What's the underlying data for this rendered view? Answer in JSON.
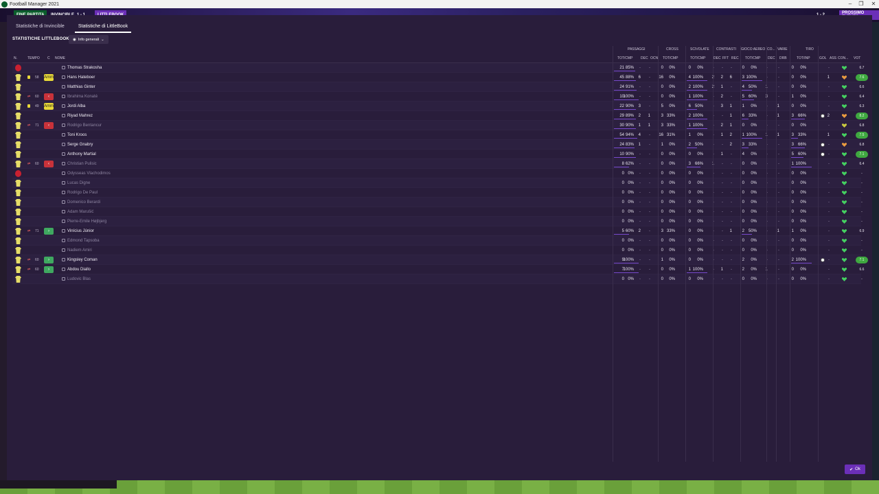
{
  "window": {
    "title": "Football Manager 2021",
    "controls": [
      "–",
      "❐",
      "✕"
    ]
  },
  "topbar": {
    "status": "FINE PARTITA",
    "home": "INVINCIBLE",
    "score": "1 - 1",
    "away": "LITTLEBOOK",
    "right_score": "1 - 2",
    "right_label": "PROSSIMO EVENTO"
  },
  "tabs": [
    {
      "label": "Statistiche di Invincible"
    },
    {
      "label": "Statistiche di LittleBook"
    }
  ],
  "section": {
    "title": "STATISTICHE LITTLEBOOK",
    "view_label": "Info generali"
  },
  "groups": [
    "PASSAGGI",
    "CROSS",
    "SCIVOLATE",
    "CONTRASTI",
    "GIOCO AEREO",
    "CO...",
    "VARIE",
    "TIRO"
  ],
  "columns": [
    "N.",
    "TEMPO",
    "C",
    "NOME",
    "TOT/CMP",
    "DEC",
    "OCN",
    "TOT/CMP",
    "TOT/CMP",
    "DEC",
    "FFT",
    "REC",
    "TOT/CMP",
    "DEC",
    "DRB",
    "TOT/INP",
    "GOL",
    "ASS",
    "CON...",
    "VOT"
  ],
  "players": [
    {
      "name": "Thomas Strakosha",
      "shirt": "red",
      "dim": false,
      "pass": "21",
      "passpct": "85%",
      "dec": "-",
      "ocn": "-",
      "cross": "0",
      "crosspct": "0%",
      "sciv": "0",
      "scivpct": "0%",
      "cdec": "-",
      "fft": "-",
      "rec": "-",
      "air": "0",
      "airpct": "0%",
      "co": "-",
      "drb": "-",
      "tiro": "0",
      "tiropct": "0%",
      "gol": "",
      "ass": "-",
      "heart": "green",
      "vot": "6.7"
    },
    {
      "name": "Hans Hateboer",
      "shirt": "yellow",
      "dim": false,
      "card": true,
      "minute": "58",
      "sub": "bkg",
      "subtext": "Amm.",
      "pass": "45",
      "passpct": "88%",
      "dec": "6",
      "ocn": "-",
      "cross": "16",
      "crosspct": "0%",
      "sciv": "4",
      "scivpct": "100%",
      "cdec": "2",
      "fft": "2",
      "rec": "6",
      "air": "3",
      "airpct": "100%",
      "co": "-",
      "drb": "-",
      "tiro": "0",
      "tiropct": "0%",
      "gol": "",
      "ass": "1",
      "heart": "orange",
      "vot": "7.6"
    },
    {
      "name": "Matthias Ginter",
      "shirt": "yellow",
      "dim": false,
      "pass": "24",
      "passpct": "91%",
      "dec": "-",
      "ocn": "-",
      "cross": "0",
      "crosspct": "0%",
      "sciv": "2",
      "scivpct": "100%",
      "cdec": "2",
      "fft": "1",
      "rec": "-",
      "air": "4",
      "airpct": "50%",
      "co": "1",
      "drb": "-",
      "tiro": "0",
      "tiropct": "0%",
      "gol": "",
      "ass": "-",
      "heart": "green",
      "vot": "6.6"
    },
    {
      "name": "Ibrahima Konaté",
      "shirt": "yellow",
      "dim": true,
      "swap": "⇄",
      "minute": "60",
      "sub": "out",
      "pass": "10",
      "passpct": "100%",
      "dec": "-",
      "ocn": "-",
      "cross": "0",
      "crosspct": "0%",
      "sciv": "1",
      "scivpct": "100%",
      "cdec": "-",
      "fft": "2",
      "rec": "-",
      "air": "5",
      "airpct": "60%",
      "co": "3",
      "drb": "-",
      "tiro": "1",
      "tiropct": "0%",
      "gol": "",
      "ass": "-",
      "heart": "green",
      "vot": "6.4"
    },
    {
      "name": "Jordi Alba",
      "shirt": "yellow",
      "dim": false,
      "card": true,
      "minute": "49",
      "sub": "bkg",
      "subtext": "Amm.",
      "pass": "22",
      "passpct": "90%",
      "dec": "3",
      "ocn": "-",
      "cross": "5",
      "crosspct": "0%",
      "sciv": "6",
      "scivpct": "50%",
      "cdec": "-",
      "fft": "3",
      "rec": "1",
      "air": "1",
      "airpct": "0%",
      "co": "-",
      "drb": "1",
      "tiro": "0",
      "tiropct": "0%",
      "gol": "",
      "ass": "-",
      "heart": "green",
      "vot": "6.3"
    },
    {
      "name": "Riyad Mahrez",
      "shirt": "yellow",
      "dim": false,
      "pass": "29",
      "passpct": "89%",
      "dec": "2",
      "ocn": "1",
      "cross": "3",
      "crosspct": "33%",
      "sciv": "2",
      "scivpct": "100%",
      "cdec": "-",
      "fft": "-",
      "rec": "1",
      "air": "6",
      "airpct": "33%",
      "co": "-",
      "drb": "1",
      "tiro": "3",
      "tiropct": "66%",
      "gol": "ball",
      "ass": "2",
      "heart": "orange",
      "vot": "8.2"
    },
    {
      "name": "Rodrigo Bentancur",
      "shirt": "yellow",
      "dim": true,
      "swap": "⇄",
      "minute": "71",
      "sub": "out",
      "pass": "30",
      "passpct": "90%",
      "dec": "1",
      "ocn": "1",
      "cross": "3",
      "crosspct": "33%",
      "sciv": "1",
      "scivpct": "100%",
      "cdec": "-",
      "fft": "2",
      "rec": "1",
      "air": "0",
      "airpct": "0%",
      "co": "-",
      "drb": "-",
      "tiro": "0",
      "tiropct": "0%",
      "gol": "",
      "ass": "-",
      "heart": "yellow",
      "vot": "6.8"
    },
    {
      "name": "Toni Kroos",
      "shirt": "yellow",
      "dim": false,
      "pass": "54",
      "passpct": "94%",
      "dec": "4",
      "ocn": "-",
      "cross": "16",
      "crosspct": "31%",
      "sciv": "1",
      "scivpct": "0%",
      "cdec": "-",
      "fft": "1",
      "rec": "2",
      "air": "1",
      "airpct": "100%",
      "co": "1",
      "drb": "1",
      "tiro": "3",
      "tiropct": "33%",
      "gol": "",
      "ass": "1",
      "heart": "green",
      "vot": "7.5"
    },
    {
      "name": "Serge Gnabry",
      "shirt": "yellow",
      "dim": false,
      "pass": "24",
      "passpct": "83%",
      "dec": "1",
      "ocn": "-",
      "cross": "1",
      "crosspct": "0%",
      "sciv": "2",
      "scivpct": "50%",
      "cdec": "-",
      "fft": "-",
      "rec": "2",
      "air": "3",
      "airpct": "33%",
      "co": "-",
      "drb": "-",
      "tiro": "3",
      "tiropct": "66%",
      "gol": "ball",
      "ass": "-",
      "heart": "orange",
      "vot": "6.8"
    },
    {
      "name": "Anthony Martial",
      "shirt": "yellow",
      "dim": false,
      "pass": "10",
      "passpct": "90%",
      "dec": "-",
      "ocn": "-",
      "cross": "0",
      "crosspct": "0%",
      "sciv": "0",
      "scivpct": "0%",
      "cdec": "-",
      "fft": "1",
      "rec": "-",
      "air": "4",
      "airpct": "0%",
      "co": "-",
      "drb": "-",
      "tiro": "5",
      "tiropct": "60%",
      "gol": "ball",
      "ass": "-",
      "heart": "green",
      "vot": "7.1"
    },
    {
      "name": "Christian Pulisic",
      "shirt": "yellow",
      "dim": true,
      "swap": "⇄",
      "minute": "60",
      "sub": "out",
      "pass": "8",
      "passpct": "62%",
      "dec": "-",
      "ocn": "-",
      "cross": "0",
      "crosspct": "0%",
      "sciv": "3",
      "scivpct": "66%",
      "cdec": "1",
      "fft": "-",
      "rec": "-",
      "air": "0",
      "airpct": "0%",
      "co": "-",
      "drb": "-",
      "tiro": "1",
      "tiropct": "100%",
      "gol": "",
      "ass": "-",
      "heart": "green",
      "vot": "6.4"
    },
    {
      "name": "Odysseas Vlachodimos",
      "shirt": "red",
      "dim": true,
      "pass": "0",
      "passpct": "0%",
      "dec": "-",
      "ocn": "-",
      "cross": "0",
      "crosspct": "0%",
      "sciv": "0",
      "scivpct": "0%",
      "cdec": "-",
      "fft": "-",
      "rec": "-",
      "air": "0",
      "airpct": "0%",
      "co": "-",
      "drb": "-",
      "tiro": "0",
      "tiropct": "0%",
      "gol": "",
      "ass": "-",
      "heart": "green",
      "vot": "-"
    },
    {
      "name": "Lucas Digne",
      "shirt": "yellow",
      "dim": true,
      "pass": "0",
      "passpct": "0%",
      "dec": "-",
      "ocn": "-",
      "cross": "0",
      "crosspct": "0%",
      "sciv": "0",
      "scivpct": "0%",
      "cdec": "-",
      "fft": "-",
      "rec": "-",
      "air": "0",
      "airpct": "0%",
      "co": "-",
      "drb": "-",
      "tiro": "0",
      "tiropct": "0%",
      "gol": "",
      "ass": "-",
      "heart": "green",
      "vot": "-"
    },
    {
      "name": "Rodrigo De Paul",
      "shirt": "yellow",
      "dim": true,
      "pass": "0",
      "passpct": "0%",
      "dec": "-",
      "ocn": "-",
      "cross": "0",
      "crosspct": "0%",
      "sciv": "0",
      "scivpct": "0%",
      "cdec": "-",
      "fft": "-",
      "rec": "-",
      "air": "0",
      "airpct": "0%",
      "co": "-",
      "drb": "-",
      "tiro": "0",
      "tiropct": "0%",
      "gol": "",
      "ass": "-",
      "heart": "green",
      "vot": "-"
    },
    {
      "name": "Domenico Berardi",
      "shirt": "yellow",
      "dim": true,
      "pass": "0",
      "passpct": "0%",
      "dec": "-",
      "ocn": "-",
      "cross": "0",
      "crosspct": "0%",
      "sciv": "0",
      "scivpct": "0%",
      "cdec": "-",
      "fft": "-",
      "rec": "-",
      "air": "0",
      "airpct": "0%",
      "co": "-",
      "drb": "-",
      "tiro": "0",
      "tiropct": "0%",
      "gol": "",
      "ass": "-",
      "heart": "green",
      "vot": "-"
    },
    {
      "name": "Adam Marušić",
      "shirt": "yellow",
      "dim": true,
      "pass": "0",
      "passpct": "0%",
      "dec": "-",
      "ocn": "-",
      "cross": "0",
      "crosspct": "0%",
      "sciv": "0",
      "scivpct": "0%",
      "cdec": "-",
      "fft": "-",
      "rec": "-",
      "air": "0",
      "airpct": "0%",
      "co": "-",
      "drb": "-",
      "tiro": "0",
      "tiropct": "0%",
      "gol": "",
      "ass": "-",
      "heart": "green",
      "vot": "-"
    },
    {
      "name": "Pierre-Emile Højbjerg",
      "shirt": "yellow",
      "dim": true,
      "pass": "0",
      "passpct": "0%",
      "dec": "-",
      "ocn": "-",
      "cross": "0",
      "crosspct": "0%",
      "sciv": "0",
      "scivpct": "0%",
      "cdec": "-",
      "fft": "-",
      "rec": "-",
      "air": "0",
      "airpct": "0%",
      "co": "-",
      "drb": "-",
      "tiro": "0",
      "tiropct": "0%",
      "gol": "",
      "ass": "-",
      "heart": "green",
      "vot": "-"
    },
    {
      "name": "Vinícius Júnior",
      "shirt": "yellow",
      "dim": false,
      "swap": "⇄",
      "minute": "71",
      "sub": "in",
      "pass": "5",
      "passpct": "60%",
      "dec": "2",
      "ocn": "-",
      "cross": "3",
      "crosspct": "33%",
      "sciv": "0",
      "scivpct": "0%",
      "cdec": "-",
      "fft": "-",
      "rec": "1",
      "air": "2",
      "airpct": "50%",
      "co": "-",
      "drb": "1",
      "tiro": "1",
      "tiropct": "0%",
      "gol": "",
      "ass": "-",
      "heart": "green",
      "vot": "6.9"
    },
    {
      "name": "Edmond Tapsoba",
      "shirt": "yellow",
      "dim": true,
      "pass": "0",
      "passpct": "0%",
      "dec": "-",
      "ocn": "-",
      "cross": "0",
      "crosspct": "0%",
      "sciv": "0",
      "scivpct": "0%",
      "cdec": "-",
      "fft": "-",
      "rec": "-",
      "air": "0",
      "airpct": "0%",
      "co": "-",
      "drb": "-",
      "tiro": "0",
      "tiropct": "0%",
      "gol": "",
      "ass": "-",
      "heart": "green",
      "vot": "-"
    },
    {
      "name": "Nadiem Amiri",
      "shirt": "yellow",
      "dim": true,
      "pass": "0",
      "passpct": "0%",
      "dec": "-",
      "ocn": "-",
      "cross": "0",
      "crosspct": "0%",
      "sciv": "0",
      "scivpct": "0%",
      "cdec": "-",
      "fft": "-",
      "rec": "-",
      "air": "0",
      "airpct": "0%",
      "co": "-",
      "drb": "-",
      "tiro": "0",
      "tiropct": "0%",
      "gol": "",
      "ass": "-",
      "heart": "green",
      "vot": "-"
    },
    {
      "name": "Kingsley Coman",
      "shirt": "yellow",
      "dim": false,
      "swap": "⇄",
      "minute": "60",
      "sub": "in",
      "pass": "9",
      "passpct": "100%",
      "dec": "-",
      "ocn": "-",
      "cross": "1",
      "crosspct": "0%",
      "sciv": "0",
      "scivpct": "0%",
      "cdec": "-",
      "fft": "-",
      "rec": "-",
      "air": "2",
      "airpct": "0%",
      "co": "-",
      "drb": "-",
      "tiro": "2",
      "tiropct": "100%",
      "gol": "ball",
      "ass": "-",
      "heart": "green",
      "vot": "7.1"
    },
    {
      "name": "Abdou Diallo",
      "shirt": "yellow",
      "dim": false,
      "swap": "⇄",
      "minute": "60",
      "sub": "in",
      "pass": "7",
      "passpct": "100%",
      "dec": "-",
      "ocn": "-",
      "cross": "0",
      "crosspct": "0%",
      "sciv": "1",
      "scivpct": "100%",
      "cdec": "-",
      "fft": "1",
      "rec": "-",
      "air": "2",
      "airpct": "0%",
      "co": "1",
      "drb": "-",
      "tiro": "0",
      "tiropct": "0%",
      "gol": "",
      "ass": "-",
      "heart": "green",
      "vot": "6.6"
    },
    {
      "name": "Ludovic Blas",
      "shirt": "yellow",
      "dim": true,
      "pass": "0",
      "passpct": "0%",
      "dec": "-",
      "ocn": "-",
      "cross": "0",
      "crosspct": "0%",
      "sciv": "0",
      "scivpct": "0%",
      "cdec": "-",
      "fft": "-",
      "rec": "-",
      "air": "0",
      "airpct": "0%",
      "co": "-",
      "drb": "-",
      "tiro": "0",
      "tiropct": "0%",
      "gol": "",
      "ass": "-",
      "heart": "green",
      "vot": "-"
    }
  ],
  "ok_label": "Ok",
  "colors": {
    "panel": "#291d3b",
    "accent": "#7a4bd0",
    "ok": "#6b2fb8",
    "rating_high": "#3fa840"
  }
}
